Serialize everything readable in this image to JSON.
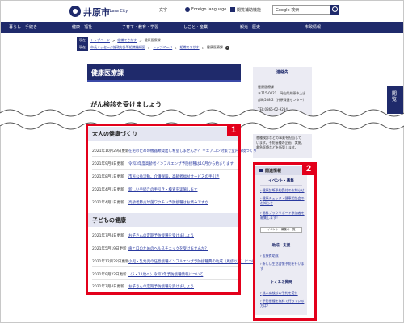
{
  "header": {
    "logo_text": "井原市",
    "logo_sub": "Ibara City",
    "util_text": "文字",
    "util_lang": "Foreign language",
    "util_read": "閲覧補助機能",
    "search_value": "Google 検索"
  },
  "nav": {
    "items": [
      "暮らし・手続き",
      "健康・福祉",
      "子育て・教育・学習",
      "しごと・産業",
      "観光・歴史",
      "市政情報"
    ]
  },
  "breadcrumbs": {
    "row1": {
      "tag": "現在",
      "items": [
        "トップページ",
        "組織でさがす",
        "健康医療課"
      ]
    },
    "row2": {
      "tag": "現在",
      "items": [
        "市長メッセージ施政方針等組織機構図",
        "トップページ",
        "組織でさがす",
        "健康医療課"
      ],
      "badge": "1"
    }
  },
  "page": {
    "title": "健康医療課",
    "partial_heading": "がん検診を受けましょう"
  },
  "dept": {
    "title": "連絡先",
    "lines": [
      "健康医療課",
      "〒715-0021　岡山県井原市上出",
      "部町588-2（井原保健センター）",
      "TEL:0866-62-9234"
    ],
    "note_lines": [
      "各種検診などの事業を担当して",
      "います。予防接種の企画、実施、",
      "救急医療などを所管します。"
    ]
  },
  "main": {
    "sections": [
      {
        "heading": "大人の健康づくり",
        "rows": [
          {
            "date": "2021年10月29日更新",
            "title": "在宅のための機器類貸出し希望しませんか？ ＝エアコン対策で室内環境づくり"
          },
          {
            "date": "2021年9月8日更新",
            "title": "令和3年度高齢者インフルエンザ予防接種は10月から始まります"
          },
          {
            "date": "2021年8月1日更新",
            "title": "市民公益活動、介護保険、高齢者福祉サービスの手引き"
          },
          {
            "date": "2021年4月1日更新",
            "title": "新しい手続きの手引き・検査を実施します"
          },
          {
            "date": "2021年4月1日更新",
            "title": "高齢者肺炎球菌ワクチン予防接種はお済みですか"
          }
        ]
      },
      {
        "heading": "子どもの健康",
        "rows": [
          {
            "date": "2021年7月4日更新",
            "title": "お子さんの定期予防接種を受けましょう"
          },
          {
            "date": "2021年5月19日更新",
            "title": "歯と口のためのヘルスチェックを受けませんか？"
          },
          {
            "date": "2021年12月22日更新",
            "title": "小児・乳幼児の任意接種インフルエンザ予防接種費の助成（風疹以外）について"
          },
          {
            "date": "2021年9月22日更新",
            "title": "〈5・11歳へ〉令和3年予防接種情報について"
          },
          {
            "date": "2021年7月4日更新",
            "title": "お子さんの定期予防接種を受けましょう"
          }
        ]
      }
    ]
  },
  "side_nav": {
    "title": "関連情報",
    "cats": [
      {
        "label": "イベント・募集",
        "links": [
          "健康診断予約受付のお知らせ",
          "健康チェック・健康相談会のお知らせ",
          "歯科ブックサポート参加者を募集します！"
        ],
        "button": "イベント・募集の一覧"
      },
      {
        "label": "助成・支援",
        "links": [
          "医療費助成",
          "新しい生活習慣予防を行います"
        ]
      },
      {
        "label": "よくある質問",
        "links": [
          "成人病検診の予約を受付",
          "予防接種を無料で行っている方は？"
        ]
      }
    ]
  },
  "annotations": [
    "1",
    "2"
  ],
  "side_tab": "閲覧",
  "colors": {
    "brand": "#1f2a6b",
    "annotation": "#e3001b",
    "link": "#2a3aa0",
    "section_bg": "#e4e6f2",
    "side_bg": "#ebebf3"
  }
}
